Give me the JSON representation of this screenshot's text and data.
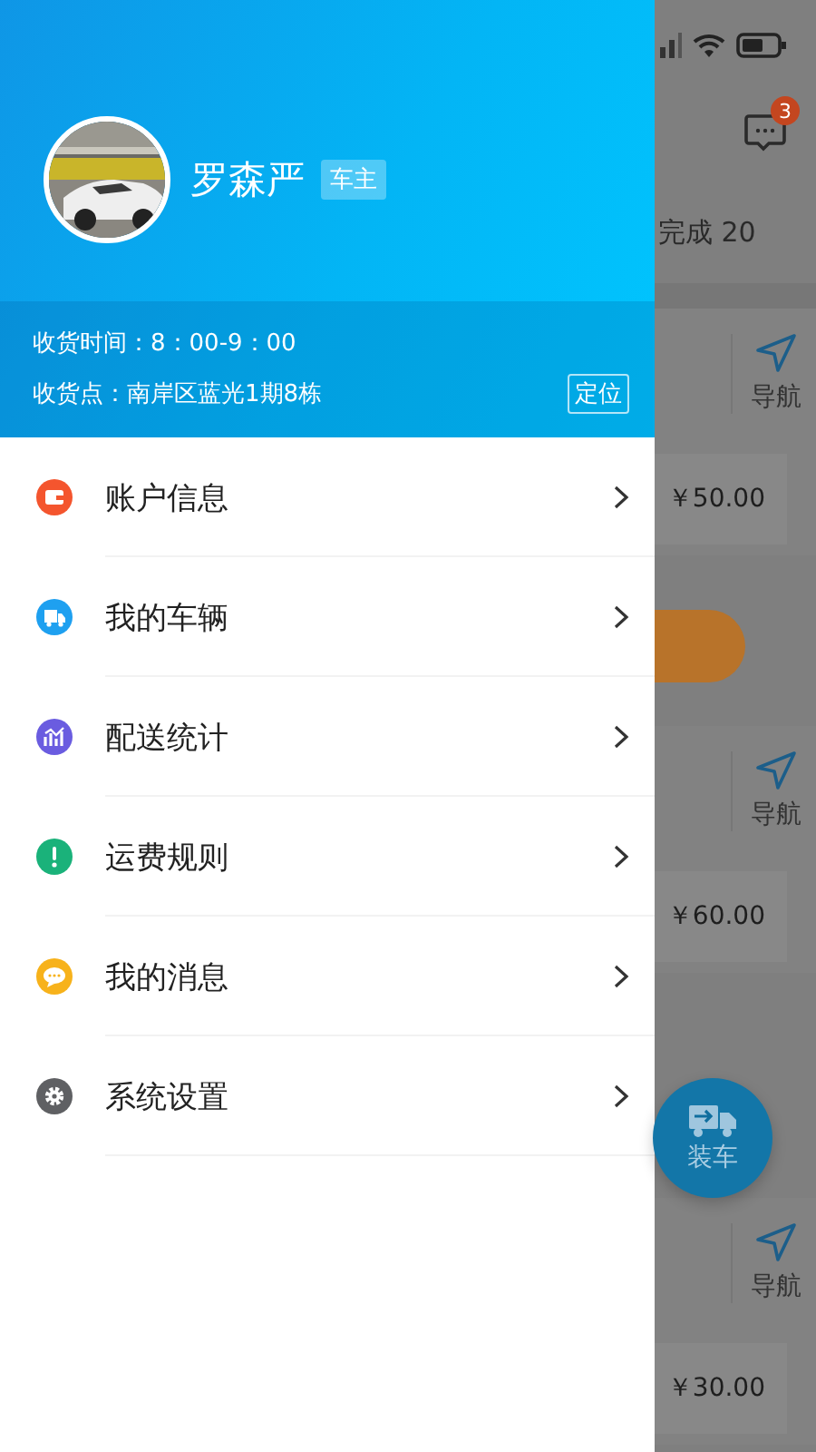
{
  "drawer": {
    "user": {
      "name": "罗森严",
      "role": "车主"
    },
    "delivery": {
      "time": "收货时间：8：00-9：00",
      "place": "收货点：南岸区蓝光1期8栋",
      "locate_button": "定位"
    },
    "menu": [
      {
        "label": "账户信息",
        "kind": "wallet",
        "color": "#f4552e"
      },
      {
        "label": "我的车辆",
        "kind": "truck",
        "color": "#1ea0f0"
      },
      {
        "label": "配送统计",
        "kind": "chart",
        "color": "#6a5ce0"
      },
      {
        "label": "运费规则",
        "kind": "alert",
        "color": "#1ab27a"
      },
      {
        "label": "我的消息",
        "kind": "chat",
        "color": "#f7b21b"
      },
      {
        "label": "系统设置",
        "kind": "gear",
        "color": "#5f6063"
      }
    ]
  },
  "background_page": {
    "message_badge": "3",
    "completed": "完成 20",
    "orders": [
      {
        "nav": "导航",
        "fee": "￥50.00",
        "action_button": true
      },
      {
        "nav": "导航",
        "fee": "￥60.00",
        "action_button": false
      },
      {
        "nav": "导航",
        "fee": "￥30.00",
        "action_button": false
      }
    ],
    "fab": "装车"
  }
}
